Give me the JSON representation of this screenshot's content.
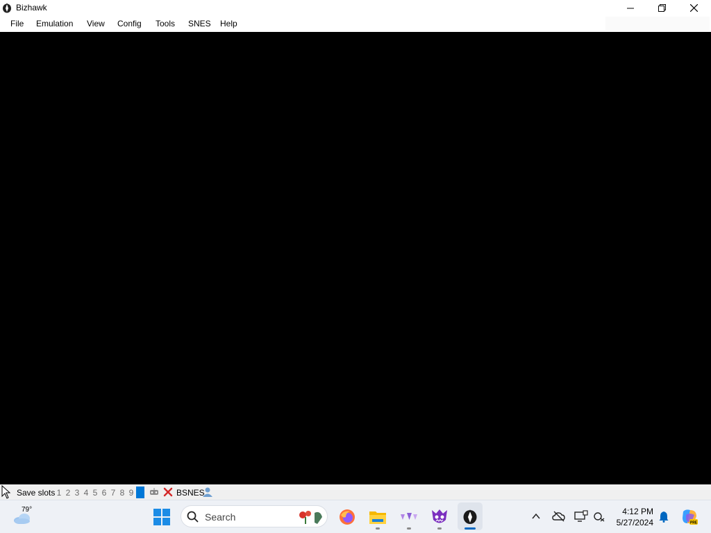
{
  "window": {
    "title": "Bizhawk"
  },
  "menu": {
    "items": [
      "File",
      "Emulation",
      "View",
      "Config",
      "Tools",
      "SNES",
      "Help"
    ]
  },
  "statusbar": {
    "save_slots_label": "Save slots",
    "slots": [
      "1",
      "2",
      "3",
      "4",
      "5",
      "6",
      "7",
      "8",
      "9"
    ],
    "selected_slot": "0",
    "core": "BSNES"
  },
  "taskbar": {
    "weather_temp": "79°",
    "search_placeholder": "Search",
    "clock_time": "4:12 PM",
    "clock_date": "5/27/2024"
  },
  "colors": {
    "accent": "#0078d7",
    "screen": "#000000"
  }
}
